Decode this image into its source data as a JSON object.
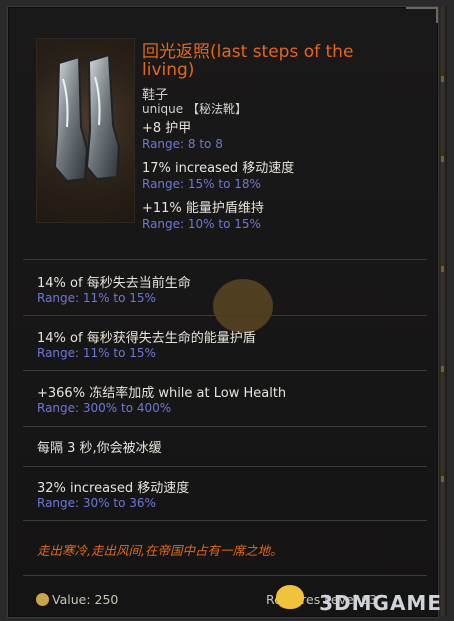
{
  "item": {
    "name": "回光返照(last steps of the living)",
    "type": "鞋子",
    "subtype": "unique 【秘法靴】",
    "stats": [
      {
        "text": "+8 护甲",
        "range": "Range: 8 to 8"
      },
      {
        "text": "17% increased 移动速度",
        "range": "Range: 15% to 18%"
      },
      {
        "text": "+11% 能量护盾维持",
        "range": "Range: 10% to 15%"
      }
    ],
    "mods": [
      {
        "text": "14% of 每秒失去当前生命",
        "range": "Range: 11% to 15%"
      },
      {
        "text": "14% of 每秒获得失去生命的能量护盾",
        "range": "Range: 11% to 15%"
      },
      {
        "text": "+366% 冻结率加成 while at Low Health",
        "range": "Range: 300% to 400%"
      },
      {
        "text": "每隔 3 秒,你会被冰缓",
        "range": ""
      },
      {
        "text": "32% increased 移动速度",
        "range": "Range: 30% to 36%"
      }
    ],
    "flavor": "走出寒冷,走出风间,在帝国中占有一席之地。",
    "value_label": "Value: 250",
    "requires_label": "Requires Level 63"
  },
  "watermark": "3DMGAME",
  "colors": {
    "name": "#e3671c",
    "range": "#6c78d6",
    "text": "#e7e4dc",
    "flavor": "#e06a1b"
  }
}
